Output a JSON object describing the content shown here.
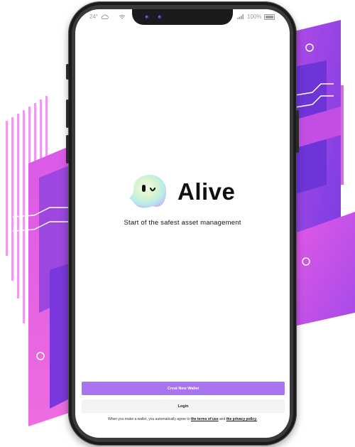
{
  "status_bar": {
    "temperature": "24°",
    "battery_percent": "100%"
  },
  "app": {
    "brand_name": "Alive",
    "tagline": "Start of the safest asset management"
  },
  "actions": {
    "create_wallet_label": "Creat New Wallet",
    "login_label": "Login"
  },
  "terms": {
    "prefix": "When you make a wallet, you automatically agree to",
    "terms_link": "the terms of use",
    "conjunction": "and",
    "privacy_link": "the privacy policy."
  },
  "colors": {
    "accent": "#a874f0",
    "background_purple": "#8a3fe0",
    "background_magenta": "#d94fe0"
  }
}
